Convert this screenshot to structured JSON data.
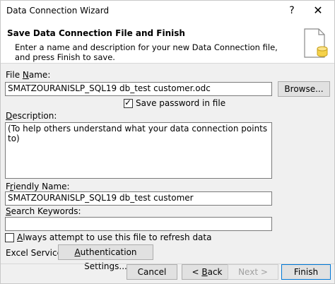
{
  "window": {
    "title": "Data Connection Wizard",
    "help_glyph": "?",
    "close_glyph": "✕"
  },
  "header": {
    "heading": "Save Data Connection File and Finish",
    "description": "Enter a name and description for your new Data Connection file, and press Finish to save."
  },
  "file_name": {
    "label_prefix": "File ",
    "label_key": "N",
    "label_rest": "ame:",
    "value": "SMATZOURANISLP_SQL19 db_test customer.odc",
    "browse_label": "Browse..."
  },
  "save_password": {
    "label": "Save password in file",
    "checked": true
  },
  "description": {
    "label_key": "D",
    "label_rest": "escription:",
    "value": "(To help others understand what your data connection points to)"
  },
  "friendly_name": {
    "label_prefix": "F",
    "label_key": "r",
    "label_rest": "iendly Name:",
    "value": "SMATZOURANISLP_SQL19 db_test customer"
  },
  "search_keywords": {
    "label_key": "S",
    "label_rest": "earch Keywords:",
    "value": ""
  },
  "always_refresh": {
    "label_key": "A",
    "label_rest": "lways attempt to use this file to refresh data",
    "checked": false
  },
  "excel_services": {
    "label": "Excel Services:",
    "auth_key": "A",
    "auth_rest": "uthentication Settings..."
  },
  "buttons": {
    "cancel": "Cancel",
    "back_prefix": "< ",
    "back_key": "B",
    "back_rest": "ack",
    "next": "Next >",
    "finish": "Finish"
  }
}
